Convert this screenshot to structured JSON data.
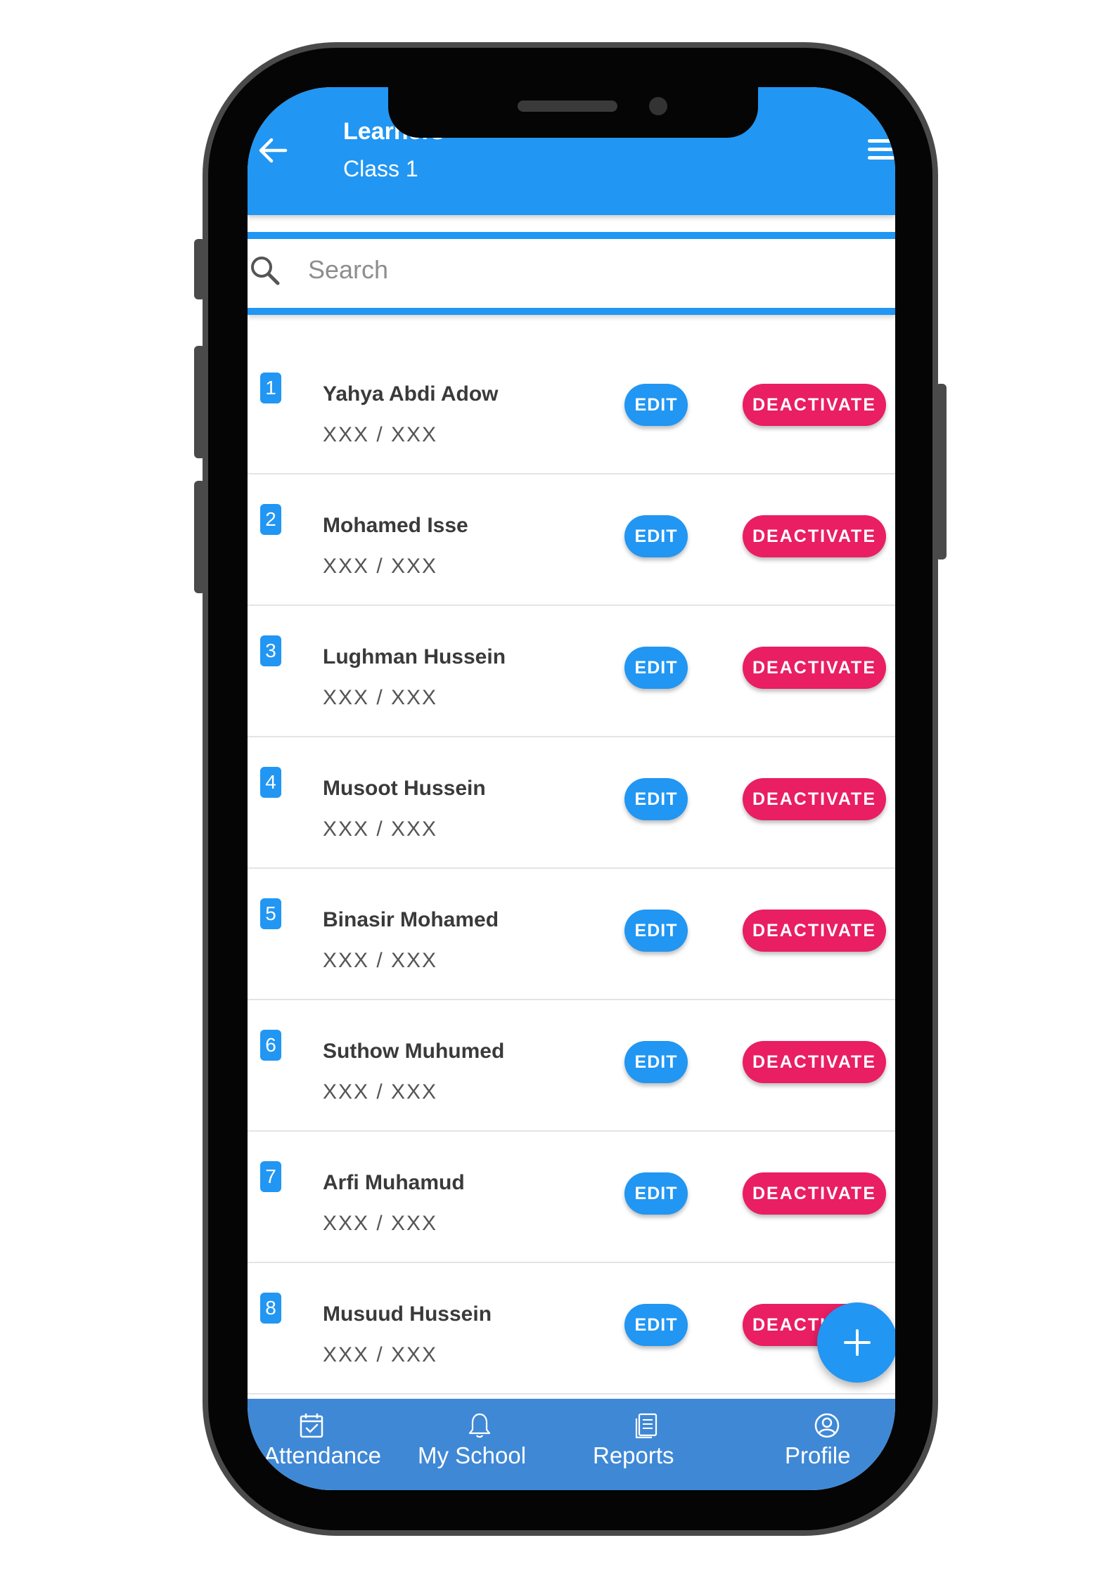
{
  "header": {
    "title": "Learners",
    "subtitle": "Class 1"
  },
  "search": {
    "placeholder": "Search"
  },
  "learners": [
    {
      "index": "1",
      "name": "Yahya Abdi Adow",
      "meta": "XXX / XXX"
    },
    {
      "index": "2",
      "name": "Mohamed Isse",
      "meta": "XXX / XXX"
    },
    {
      "index": "3",
      "name": "Lughman Hussein",
      "meta": "XXX / XXX"
    },
    {
      "index": "4",
      "name": "Musoot Hussein",
      "meta": "XXX / XXX"
    },
    {
      "index": "5",
      "name": "Binasir Mohamed",
      "meta": "XXX / XXX"
    },
    {
      "index": "6",
      "name": "Suthow Muhumed",
      "meta": "XXX / XXX"
    },
    {
      "index": "7",
      "name": "Arfi Muhamud",
      "meta": "XXX / XXX"
    },
    {
      "index": "8",
      "name": "Musuud Hussein",
      "meta": "XXX / XXX"
    }
  ],
  "actions": {
    "edit_label": "EDIT",
    "deactivate_label": "DEACTIVATE"
  },
  "fab": {
    "icon": "plus-icon"
  },
  "bottom_nav": [
    {
      "label": "Attendance",
      "icon": "calendar-check-icon"
    },
    {
      "label": "My School",
      "icon": "bell-icon"
    },
    {
      "label": "Reports",
      "icon": "document-icon"
    },
    {
      "label": "Profile",
      "icon": "user-circle-icon"
    }
  ],
  "colors": {
    "primary": "#2196f3",
    "danger": "#e91e63",
    "nav_background": "#3f88d6"
  }
}
